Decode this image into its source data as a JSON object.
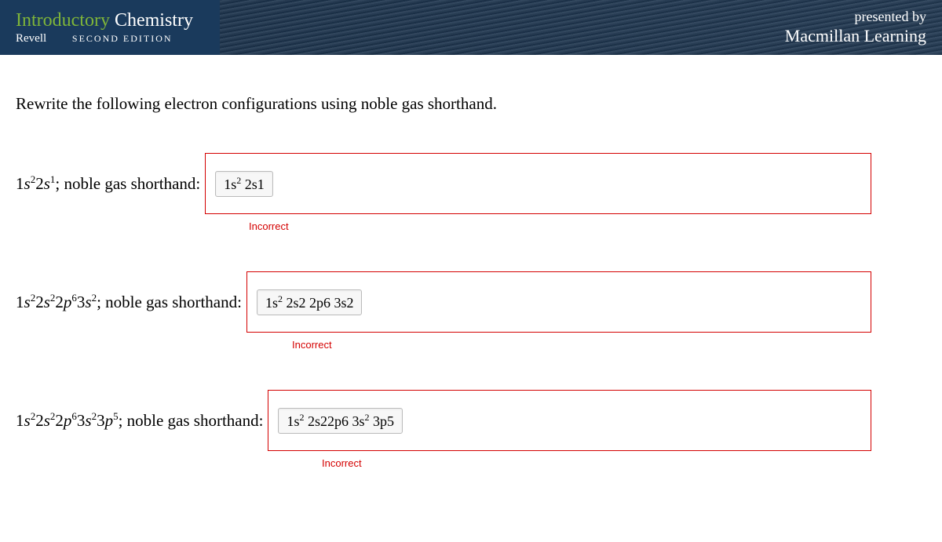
{
  "header": {
    "title_part1": "Introductory",
    "title_part2": "Chemistry",
    "author": "Revell",
    "edition": "SECOND EDITION",
    "presented_label": "presented by",
    "publisher": "Macmillan Learning"
  },
  "instruction": "Rewrite the following electron configurations using noble gas shorthand.",
  "questions": [
    {
      "config_html": "1<i>s</i><sup>2</sup>2<i>s</i><sup>1</sup>",
      "suffix": "; noble gas shorthand:",
      "answer_html": "1s<sup>2</sup> 2s1",
      "feedback": "Incorrect"
    },
    {
      "config_html": "1<i>s</i><sup>2</sup>2<i>s</i><sup>2</sup>2<i>p</i><sup>6</sup>3<i>s</i><sup>2</sup>",
      "suffix": "; noble gas shorthand:",
      "answer_html": "1s<sup>2</sup> 2s2 2p6 3s2",
      "feedback": "Incorrect"
    },
    {
      "config_html": "1<i>s</i><sup>2</sup>2<i>s</i><sup>2</sup>2<i>p</i><sup>6</sup>3<i>s</i><sup>2</sup>3<i>p</i><sup>5</sup>",
      "suffix": "; noble gas shorthand:",
      "answer_html": "1s<sup>2</sup> 2s22p6 3s<sup>2</sup> 3p5",
      "feedback": "Incorrect"
    }
  ]
}
